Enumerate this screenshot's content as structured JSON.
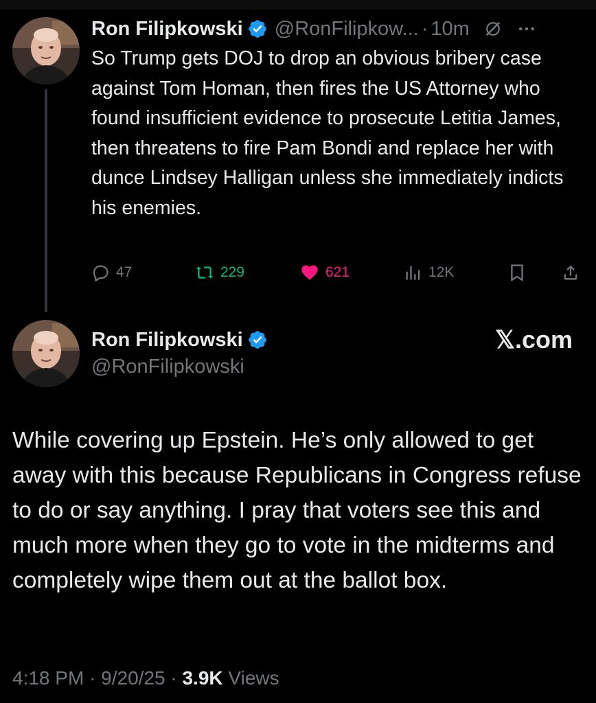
{
  "tweet1": {
    "author_name": "Ron Filipkowski",
    "handle": "@RonFilipkow...",
    "separator": "·",
    "time": "10m",
    "body": "So Trump gets DOJ to drop an obvious bribery case against Tom Homan, then fires the US Attorney who found insufficient evidence to prosecute Letitia James, then threatens to fire Pam Bondi and replace her with dunce Lindsey Halligan unless she immediately indicts his enemies.",
    "actions": {
      "replies": "47",
      "reposts": "229",
      "likes": "621",
      "views": "12K"
    }
  },
  "tweet2": {
    "author_name": "Ron Filipkowski",
    "handle": "@RonFilipkowski",
    "source_label": "𝕏.com",
    "body": "While covering up Epstein. He’s only allowed to get away with this because Republicans in Congress refuse to do or say anything. I pray that voters see this and much more when they go to vote in the midterms and completely wipe them out at the ballot box.",
    "meta": {
      "time": "4:18 PM",
      "sep1": "·",
      "date": "9/20/25",
      "sep2": "·",
      "views_count": "3.9K",
      "views_label": "Views"
    }
  },
  "colors": {
    "background": "#000000",
    "text": "#e7e9ea",
    "muted": "#71767b",
    "verified": "#1d9bf0",
    "repost": "#00ba7c",
    "like": "#f91880"
  },
  "icons": {
    "verified": "verified-badge-icon",
    "grok": "grok-icon",
    "more": "more-icon",
    "reply": "reply-icon",
    "repost": "repost-icon",
    "like": "heart-icon",
    "views": "views-icon",
    "bookmark": "bookmark-icon",
    "share": "share-icon"
  }
}
